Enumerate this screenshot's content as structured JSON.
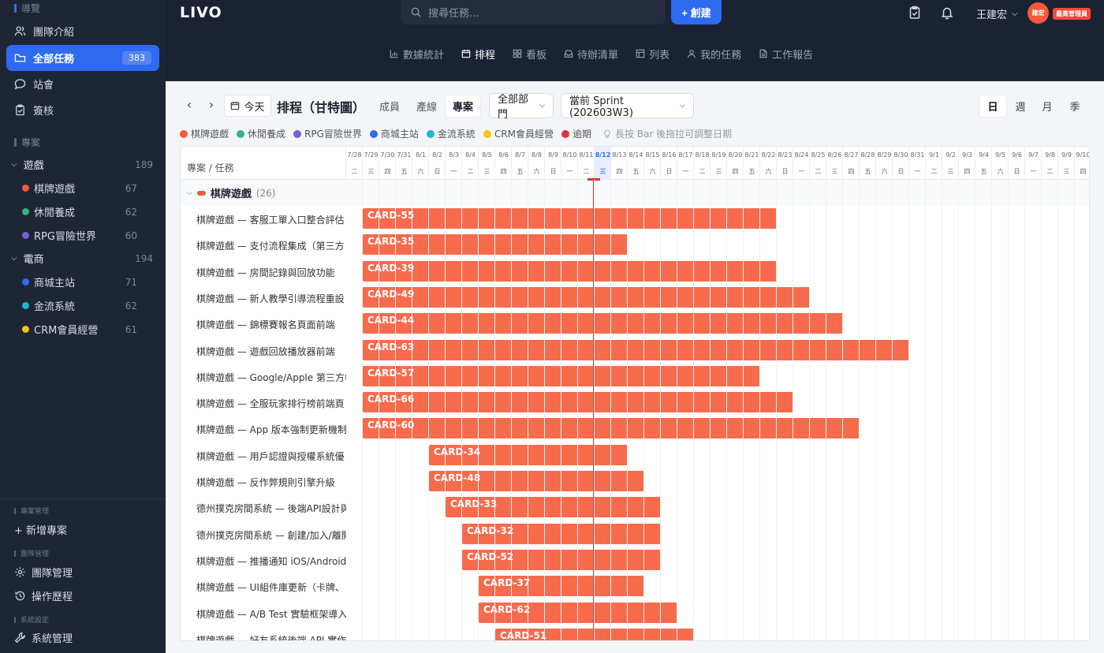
{
  "sidebar": {
    "overview_label": "導覽",
    "items": [
      {
        "label": "團隊介紹"
      },
      {
        "label": "全部任務",
        "count": "383"
      },
      {
        "label": "站會"
      },
      {
        "label": "簽核"
      }
    ],
    "projects_label": "專案",
    "groups": [
      {
        "label": "遊戲",
        "count": "189",
        "projects": [
          {
            "label": "棋牌遊戲",
            "count": "67",
            "color": "#f25a3a"
          },
          {
            "label": "休閒養成",
            "count": "62",
            "color": "#2fb77a"
          },
          {
            "label": "RPG冒險世界",
            "count": "60",
            "color": "#7b5fd6"
          }
        ]
      },
      {
        "label": "電商",
        "count": "194",
        "projects": [
          {
            "label": "商城主站",
            "count": "71",
            "color": "#2f6bf0"
          },
          {
            "label": "金流系統",
            "count": "62",
            "color": "#1fb8d4"
          },
          {
            "label": "CRM會員經營",
            "count": "61",
            "color": "#f5c518"
          }
        ]
      }
    ],
    "project_mgmt_label": "專案管理",
    "add_project": "+ 新增專案",
    "team_mgmt_label": "團隊管理",
    "team_mgmt": "團隊管理",
    "history": "操作歷程",
    "settings_label": "系統設定",
    "system_mgmt": "系統管理"
  },
  "topbar": {
    "logo": "LIVO",
    "search_placeholder": "搜尋任務...",
    "create_label": "+ 創建",
    "user_name": "王建宏",
    "avatar_text": "建宏",
    "role": "最高管理員",
    "tabs": [
      {
        "label": "數據統計",
        "icon": "bar-chart-icon"
      },
      {
        "label": "排程",
        "icon": "calendar-icon",
        "active": true
      },
      {
        "label": "看板",
        "icon": "grid-icon"
      },
      {
        "label": "待辦清單",
        "icon": "inbox-icon"
      },
      {
        "label": "列表",
        "icon": "table-icon"
      },
      {
        "label": "我的任務",
        "icon": "user-icon"
      },
      {
        "label": "工作報告",
        "icon": "document-icon"
      }
    ]
  },
  "toolbar": {
    "today": "今天",
    "title": "排程（甘特圖）",
    "segments": [
      "成員",
      "產線",
      "專案"
    ],
    "active_segment": "專案",
    "department": "全部部門",
    "sprint": "當前 Sprint (202603W3)",
    "scales": [
      "日",
      "週",
      "月",
      "季"
    ],
    "active_scale": "日"
  },
  "legend": {
    "items": [
      {
        "label": "棋牌遊戲",
        "color": "#f25a3a"
      },
      {
        "label": "休閒養成",
        "color": "#2fb77a"
      },
      {
        "label": "RPG冒險世界",
        "color": "#7b5fd6"
      },
      {
        "label": "商城主站",
        "color": "#2f6bf0"
      },
      {
        "label": "金流系統",
        "color": "#1fb8d4"
      },
      {
        "label": "CRM會員經營",
        "color": "#f5c518"
      },
      {
        "label": "逾期",
        "color": "#d93636"
      }
    ],
    "hint": "長按 Bar 後拖拉可調整日期"
  },
  "gantt": {
    "left_header": "專案 / 任務",
    "days": [
      {
        "d": "7/28",
        "w": "二"
      },
      {
        "d": "7/29",
        "w": "三"
      },
      {
        "d": "7/30",
        "w": "四"
      },
      {
        "d": "7/31",
        "w": "五"
      },
      {
        "d": "8/1",
        "w": "六"
      },
      {
        "d": "8/2",
        "w": "日"
      },
      {
        "d": "8/3",
        "w": "一"
      },
      {
        "d": "8/4",
        "w": "二"
      },
      {
        "d": "8/5",
        "w": "三"
      },
      {
        "d": "8/6",
        "w": "四"
      },
      {
        "d": "8/7",
        "w": "五"
      },
      {
        "d": "8/8",
        "w": "六"
      },
      {
        "d": "8/9",
        "w": "日"
      },
      {
        "d": "8/10",
        "w": "一"
      },
      {
        "d": "8/11",
        "w": "二"
      },
      {
        "d": "8/12",
        "w": "三"
      },
      {
        "d": "8/13",
        "w": "四"
      },
      {
        "d": "8/14",
        "w": "五"
      },
      {
        "d": "8/15",
        "w": "六"
      },
      {
        "d": "8/16",
        "w": "日"
      },
      {
        "d": "8/17",
        "w": "一"
      },
      {
        "d": "8/18",
        "w": "二"
      },
      {
        "d": "8/19",
        "w": "三"
      },
      {
        "d": "8/20",
        "w": "四"
      },
      {
        "d": "8/21",
        "w": "五"
      },
      {
        "d": "8/22",
        "w": "六"
      },
      {
        "d": "8/23",
        "w": "日"
      },
      {
        "d": "8/24",
        "w": "一"
      },
      {
        "d": "8/25",
        "w": "二"
      },
      {
        "d": "8/26",
        "w": "三"
      },
      {
        "d": "8/27",
        "w": "四"
      },
      {
        "d": "8/28",
        "w": "五"
      },
      {
        "d": "8/29",
        "w": "六"
      },
      {
        "d": "8/30",
        "w": "日"
      },
      {
        "d": "8/31",
        "w": "一"
      },
      {
        "d": "9/1",
        "w": "二"
      },
      {
        "d": "9/2",
        "w": "三"
      },
      {
        "d": "9/3",
        "w": "四"
      },
      {
        "d": "9/4",
        "w": "五"
      },
      {
        "d": "9/5",
        "w": "六"
      },
      {
        "d": "9/6",
        "w": "日"
      },
      {
        "d": "9/7",
        "w": "一"
      },
      {
        "d": "9/8",
        "w": "二"
      },
      {
        "d": "9/9",
        "w": "三"
      },
      {
        "d": "9/10",
        "w": "四"
      }
    ],
    "today": "8/12",
    "group": {
      "label": "棋牌遊戲",
      "count": "(26)"
    },
    "rows": [
      {
        "label": "棋牌遊戲 — 客服工單入口整合評估",
        "card": "CARD-55",
        "start": "7/29",
        "end": "8/22"
      },
      {
        "label": "棋牌遊戲 — 支付流程集成（第三方",
        "card": "CARD-35",
        "start": "7/29",
        "end": "8/13"
      },
      {
        "label": "棋牌遊戲 — 房間記錄與回放功能",
        "card": "CARD-39",
        "start": "7/29",
        "end": "8/22"
      },
      {
        "label": "棋牌遊戲 — 新人教學引導流程重設",
        "card": "CARD-49",
        "start": "7/29",
        "end": "8/24"
      },
      {
        "label": "棋牌遊戲 — 錦標賽報名頁面前端",
        "card": "CARD-44",
        "start": "7/29",
        "end": "8/26"
      },
      {
        "label": "棋牌遊戲 — 遊戲回放播放器前端",
        "card": "CARD-63",
        "start": "7/29",
        "end": "8/30"
      },
      {
        "label": "棋牌遊戲 — Google/Apple 第三方帳",
        "card": "CARD-57",
        "start": "7/29",
        "end": "8/21"
      },
      {
        "label": "棋牌遊戲 — 全服玩家排行榜前端頁",
        "card": "CARD-66",
        "start": "7/29",
        "end": "8/23"
      },
      {
        "label": "棋牌遊戲 — App 版本強制更新機制",
        "card": "CARD-60",
        "start": "7/29",
        "end": "8/27"
      },
      {
        "label": "棋牌遊戲 — 用戶認證與授權系統優",
        "card": "CARD-34",
        "start": "8/2",
        "end": "8/13"
      },
      {
        "label": "棋牌遊戲 — 反作弊規則引擎升級",
        "card": "CARD-48",
        "start": "8/2",
        "end": "8/14"
      },
      {
        "label": "德州撲克房間系統 — 後端API設計與",
        "card": "CARD-33",
        "start": "8/3",
        "end": "8/15"
      },
      {
        "label": "德州撲克房間系統 — 創建/加入/離開",
        "card": "CARD-32",
        "start": "8/4",
        "end": "8/15"
      },
      {
        "label": "棋牌遊戲 — 推播通知 iOS/Android",
        "card": "CARD-52",
        "start": "8/4",
        "end": "8/15"
      },
      {
        "label": "棋牌遊戲 — UI組件庫更新（卡牌、",
        "card": "CARD-37",
        "start": "8/5",
        "end": "8/14"
      },
      {
        "label": "棋牌遊戲 — A/B Test 實驗框架導入",
        "card": "CARD-62",
        "start": "8/5",
        "end": "8/16"
      },
      {
        "label": "棋牌遊戲 — 好友系統後端 API 實作",
        "card": "CARD-51",
        "start": "8/6",
        "end": "8/17"
      }
    ]
  }
}
